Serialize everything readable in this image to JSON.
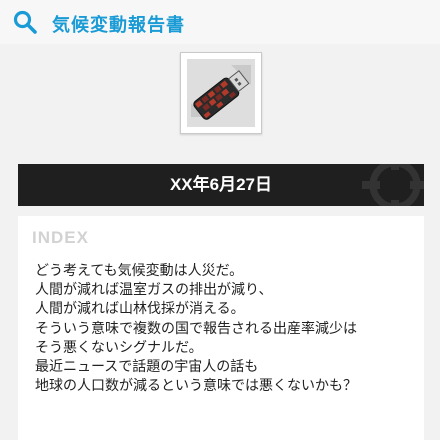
{
  "header": {
    "title": "気候変動報告書",
    "icon": "search-icon"
  },
  "item": {
    "icon": "usb-dongle-icon"
  },
  "banner": {
    "date": "XX年6月27日"
  },
  "panel": {
    "index_label": "INDEX",
    "lines": [
      "どう考えても気候変動は人災だ。",
      "人間が減れば温室ガスの排出が減り、",
      "人間が減れば山林伐採が消える。",
      "そういう意味で複数の国で報告される出産率減少は",
      "そう悪くないシグナルだ。",
      "最近ニュースで話題の宇宙人の話も",
      "地球の人口数が減るという意味では悪くないかも？"
    ]
  },
  "colors": {
    "accent": "#1a9bd6",
    "banner_bg": "#1f1f1f",
    "page_bg": "#f2f2f2"
  }
}
